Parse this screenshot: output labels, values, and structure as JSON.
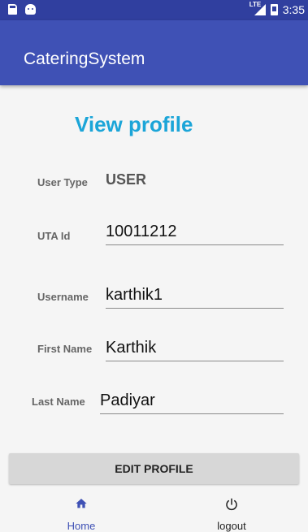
{
  "status_bar": {
    "time": "3:35",
    "network": "LTE"
  },
  "app_bar": {
    "title": "CateringSystem"
  },
  "main": {
    "heading": "View profile",
    "user_type": {
      "label": "User Type",
      "value": "USER"
    },
    "fields": [
      {
        "label": "UTA Id",
        "value": "10011212"
      },
      {
        "label": "Username",
        "value": "karthik1"
      },
      {
        "label": "First Name",
        "value": "Karthik"
      },
      {
        "label": "Last Name",
        "value": "Padiyar"
      }
    ],
    "edit_button": "EDIT PROFILE"
  },
  "bottom_nav": {
    "items": [
      {
        "label": "Home",
        "icon": "home-icon",
        "active": true
      },
      {
        "label": "logout",
        "icon": "power-icon",
        "active": false
      }
    ]
  },
  "colors": {
    "primary": "#3f51b5",
    "primary_dark": "#303f9f",
    "heading": "#1ba5d8",
    "active_nav": "#3f51b5"
  }
}
